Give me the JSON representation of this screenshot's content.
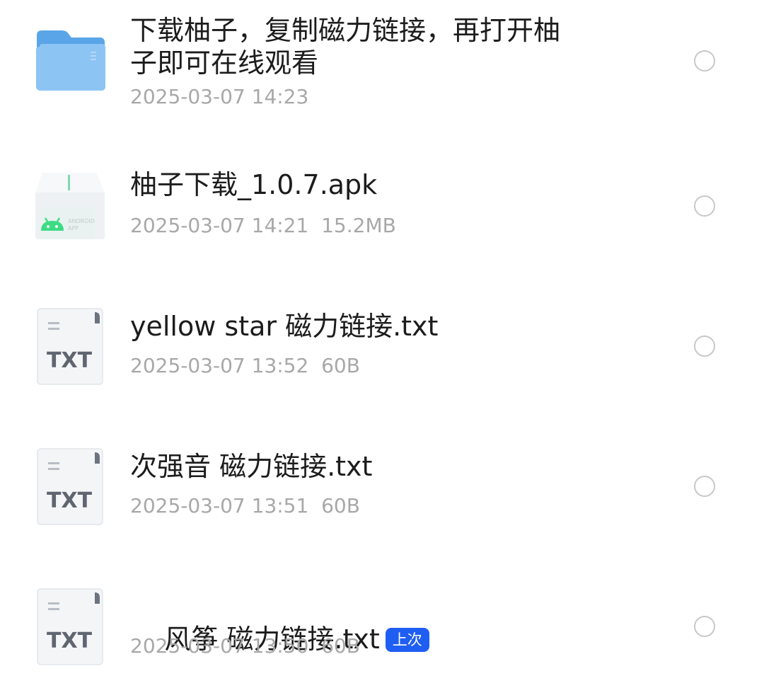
{
  "files": [
    {
      "icon": "folder-icon",
      "name": "下载柚子，复制磁力链接，再打开柚\n子即可在线观看",
      "meta": "2025-03-07 14:23"
    },
    {
      "icon": "apk-icon",
      "icon_text": "ANDROID APP",
      "name": "柚子下载_1.0.7.apk",
      "meta": "2025-03-07 14:21  15.2MB"
    },
    {
      "icon": "txt-file-icon",
      "icon_text": "TXT",
      "name": "yellow star 磁力链接.txt",
      "meta": "2025-03-07 13:52  60B"
    },
    {
      "icon": "txt-file-icon",
      "icon_text": "TXT",
      "name": "次强音 磁力链接.txt",
      "meta": "2025-03-07 13:51  60B"
    },
    {
      "icon": "txt-file-icon",
      "icon_text": "TXT",
      "name": "风筝 磁力链接.txt",
      "badge": "上次",
      "meta": "2025-03-07 13:50  60B"
    }
  ],
  "colors": {
    "badge": "#1f5ef2",
    "folder": "#6fb3ee",
    "android_green": "#3ddc84"
  }
}
